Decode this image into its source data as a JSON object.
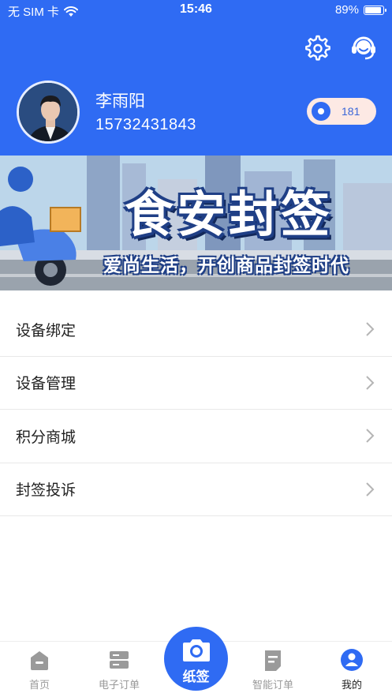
{
  "status_bar": {
    "carrier": "无 SIM 卡",
    "time": "15:46",
    "battery": "89%",
    "battery_level": 0.89
  },
  "profile": {
    "name": "李雨阳",
    "phone": "15732431843",
    "points": "181"
  },
  "banner": {
    "title": "食安封签",
    "subtitle": "爱尚生活，开创商品封签时代"
  },
  "menu": {
    "items": [
      {
        "label": "设备绑定"
      },
      {
        "label": "设备管理"
      },
      {
        "label": "积分商城"
      },
      {
        "label": "封签投诉"
      }
    ]
  },
  "tabbar": {
    "home": "首页",
    "orders": "电子订单",
    "center": "纸签",
    "smart_orders": "智能订单",
    "mine": "我的"
  },
  "colors": {
    "accent": "#2f6bf3",
    "pill_bg": "#fde9e4",
    "inactive_tab": "#9a9a9a"
  },
  "icons": [
    "wifi-icon",
    "battery-icon",
    "settings-gear-icon",
    "customer-service-icon",
    "points-coin-icon",
    "chevron-right-icon",
    "home-icon",
    "server-icon",
    "camera-icon",
    "document-icon",
    "user-icon"
  ]
}
